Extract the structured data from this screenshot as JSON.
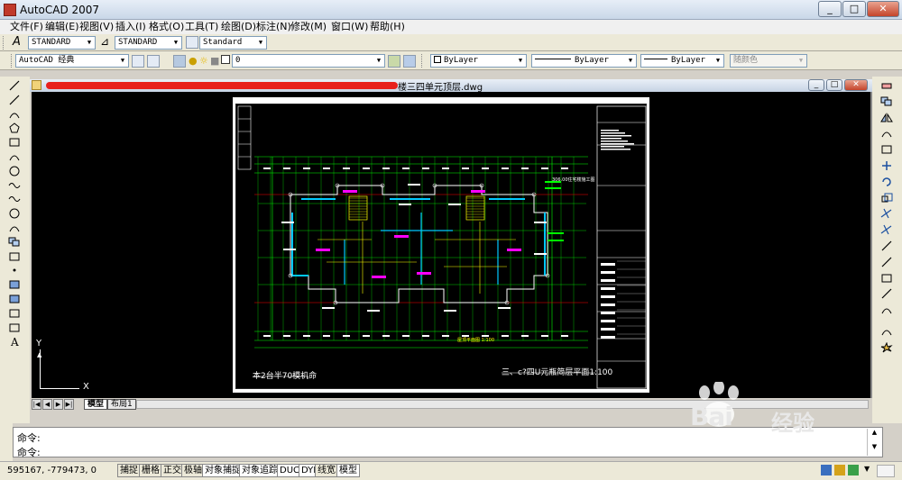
{
  "window": {
    "title": "AutoCAD 2007",
    "min": "_",
    "max": "□",
    "close": "✕"
  },
  "menu": [
    "文件(F)",
    "编辑(E)",
    "视图(V)",
    "插入(I)",
    "格式(O)",
    "工具(T)",
    "绘图(D)",
    "标注(N)",
    "修改(M)",
    "窗口(W)",
    "帮助(H)"
  ],
  "styles": {
    "text_style": "STANDARD",
    "dim_style": "STANDARD",
    "table_style": "Standard"
  },
  "layers": {
    "workspace": "AutoCAD 经典",
    "layer": "0",
    "color": "ByLayer",
    "linetype": "ByLayer",
    "lineweight": "ByLayer",
    "plot_style": "随颜色"
  },
  "document": {
    "title": "楼三四单元顶层.dwg",
    "min": "_",
    "max": "□",
    "close": "✕"
  },
  "drawing": {
    "title_left": "本2台半70模机命",
    "title_right": "三、c?四U元瓶简层平面1:100",
    "label_top": "306.00住宅楼施工图",
    "label_bottom": "屋顶平面图 1:100",
    "ucs_x": "X",
    "ucs_y": "Y"
  },
  "tabs": {
    "model": "模型",
    "layout1": "布局1"
  },
  "command": {
    "line1": "命令:",
    "line2": "命令:"
  },
  "status": {
    "coords": "595167, -779473, 0",
    "buttons": [
      "捕捉",
      "栅格",
      "正交",
      "极轴",
      "对象捕捉",
      "对象追踪",
      "DUCS",
      "DYN",
      "线宽",
      "模型"
    ]
  },
  "watermark": {
    "brand": "Bai",
    "brand2": "经验",
    "url": "jingyan.baidu.com"
  },
  "colors": {
    "canvas": "#000000",
    "accent": "#c0392b",
    "cad_green": "#00ff00",
    "cad_cyan": "#00c8ff",
    "cad_magenta": "#ff00ff",
    "cad_yellow": "#ffff00",
    "cad_red": "#ff0000"
  }
}
